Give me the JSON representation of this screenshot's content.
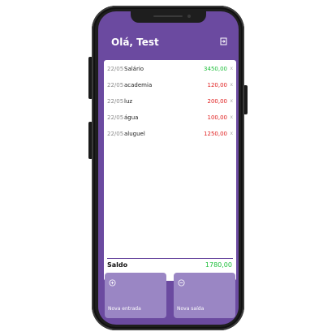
{
  "header": {
    "greeting": "Olá, Test"
  },
  "transactions": [
    {
      "date": "22/05",
      "description": "Salário",
      "value": "3450,00",
      "type": "income"
    },
    {
      "date": "22/05",
      "description": "academia",
      "value": "120,00",
      "type": "expense"
    },
    {
      "date": "22/05",
      "description": "luz",
      "value": "200,00",
      "type": "expense"
    },
    {
      "date": "22/05",
      "description": "água",
      "value": "100,00",
      "type": "expense"
    },
    {
      "date": "22/05",
      "description": "aluguel",
      "value": "1250,00",
      "type": "expense"
    }
  ],
  "delete_glyph": "x",
  "balance": {
    "label": "Saldo",
    "value": "1780,00"
  },
  "actions": {
    "new_income": {
      "label": "Nova entrada",
      "icon": "plus-circle-icon"
    },
    "new_expense": {
      "label": "Nova saída",
      "icon": "minus-circle-icon"
    }
  },
  "colors": {
    "primary": "#6b4aa0",
    "action_bg": "#9a86c4",
    "income": "#1dbf3a",
    "expense": "#e02020"
  }
}
